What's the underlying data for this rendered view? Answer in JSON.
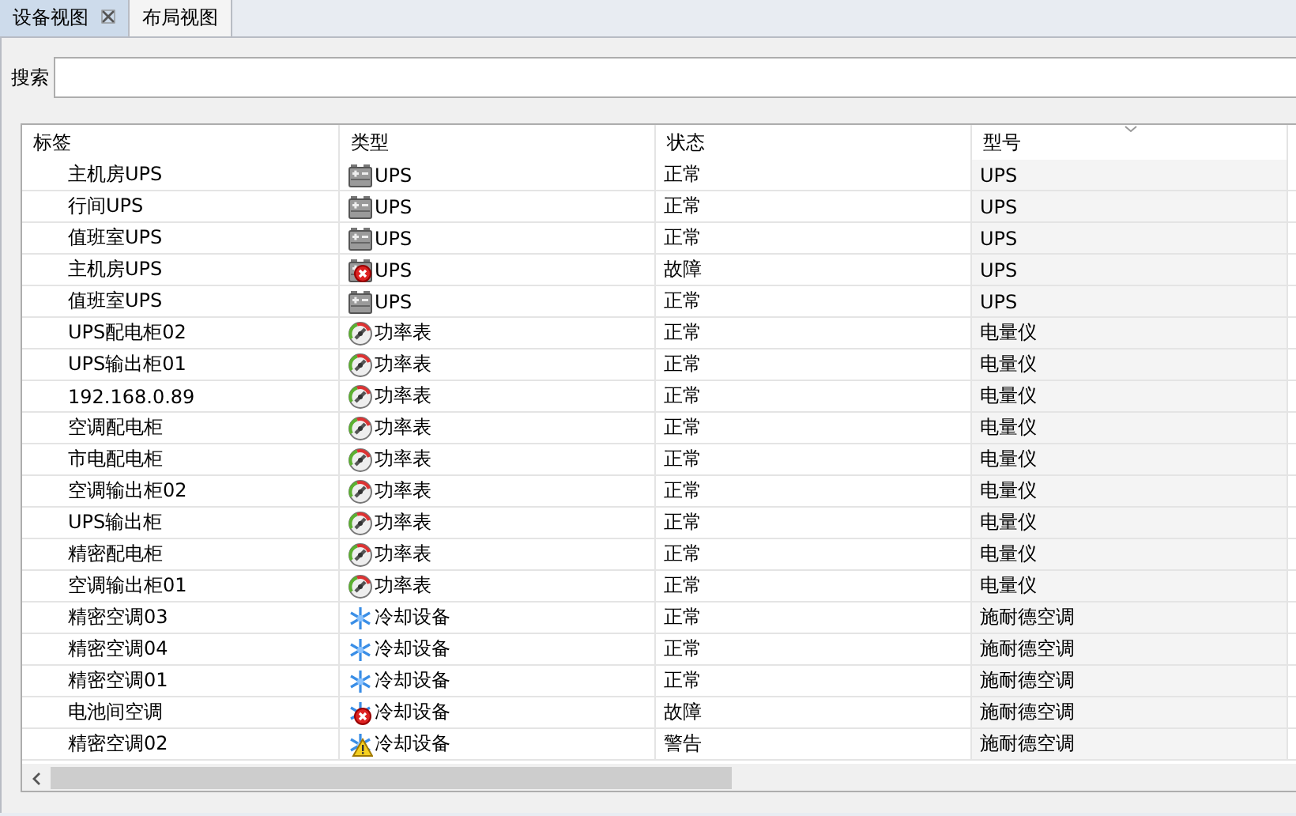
{
  "tabs": [
    {
      "label": "设备视图",
      "selected": true,
      "closable": true
    },
    {
      "label": "布局视图",
      "selected": false,
      "closable": false
    }
  ],
  "search": {
    "label": "搜索"
  },
  "table": {
    "columns": [
      {
        "label": "标签",
        "sorted": false
      },
      {
        "label": "类型",
        "sorted": false
      },
      {
        "label": "状态",
        "sorted": false
      },
      {
        "label": "型号",
        "sorted": true
      }
    ],
    "rows": [
      {
        "label": "主机房UPS",
        "type": "UPS",
        "kind": "ups",
        "fault": false,
        "warning": false,
        "status": "正常",
        "model": "UPS"
      },
      {
        "label": "行间UPS",
        "type": "UPS",
        "kind": "ups",
        "fault": false,
        "warning": false,
        "status": "正常",
        "model": "UPS"
      },
      {
        "label": "值班室UPS",
        "type": "UPS",
        "kind": "ups",
        "fault": false,
        "warning": false,
        "status": "正常",
        "model": "UPS"
      },
      {
        "label": "主机房UPS",
        "type": "UPS",
        "kind": "ups",
        "fault": true,
        "warning": false,
        "status": "故障",
        "model": "UPS"
      },
      {
        "label": "值班室UPS",
        "type": "UPS",
        "kind": "ups",
        "fault": false,
        "warning": false,
        "status": "正常",
        "model": "UPS"
      },
      {
        "label": "UPS配电柜02",
        "type": "功率表",
        "kind": "meter",
        "fault": false,
        "warning": false,
        "status": "正常",
        "model": "电量仪"
      },
      {
        "label": "UPS输出柜01",
        "type": "功率表",
        "kind": "meter",
        "fault": false,
        "warning": false,
        "status": "正常",
        "model": "电量仪"
      },
      {
        "label": "192.168.0.89",
        "type": "功率表",
        "kind": "meter",
        "fault": false,
        "warning": false,
        "status": "正常",
        "model": "电量仪"
      },
      {
        "label": "空调配电柜",
        "type": "功率表",
        "kind": "meter",
        "fault": false,
        "warning": false,
        "status": "正常",
        "model": "电量仪"
      },
      {
        "label": "市电配电柜",
        "type": "功率表",
        "kind": "meter",
        "fault": false,
        "warning": false,
        "status": "正常",
        "model": "电量仪"
      },
      {
        "label": "空调输出柜02",
        "type": "功率表",
        "kind": "meter",
        "fault": false,
        "warning": false,
        "status": "正常",
        "model": "电量仪"
      },
      {
        "label": "UPS输出柜",
        "type": "功率表",
        "kind": "meter",
        "fault": false,
        "warning": false,
        "status": "正常",
        "model": "电量仪"
      },
      {
        "label": "精密配电柜",
        "type": "功率表",
        "kind": "meter",
        "fault": false,
        "warning": false,
        "status": "正常",
        "model": "电量仪"
      },
      {
        "label": "空调输出柜01",
        "type": "功率表",
        "kind": "meter",
        "fault": false,
        "warning": false,
        "status": "正常",
        "model": "电量仪"
      },
      {
        "label": "精密空调03",
        "type": "冷却设备",
        "kind": "cooling",
        "fault": false,
        "warning": false,
        "status": "正常",
        "model": "施耐德空调"
      },
      {
        "label": "精密空调04",
        "type": "冷却设备",
        "kind": "cooling",
        "fault": false,
        "warning": false,
        "status": "正常",
        "model": "施耐德空调"
      },
      {
        "label": "精密空调01",
        "type": "冷却设备",
        "kind": "cooling",
        "fault": false,
        "warning": false,
        "status": "正常",
        "model": "施耐德空调"
      },
      {
        "label": "电池间空调",
        "type": "冷却设备",
        "kind": "cooling",
        "fault": true,
        "warning": false,
        "status": "故障",
        "model": "施耐德空调"
      },
      {
        "label": "精密空调02",
        "type": "冷却设备",
        "kind": "cooling",
        "fault": false,
        "warning": true,
        "status": "警告",
        "model": "施耐德空调"
      }
    ]
  }
}
